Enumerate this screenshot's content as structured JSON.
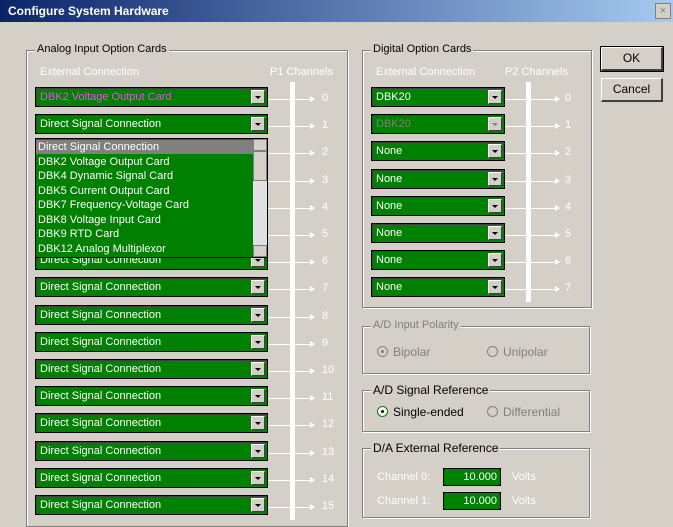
{
  "window": {
    "title": "Configure System Hardware",
    "close_label": "×"
  },
  "analog": {
    "group_label": "Analog Input Option Cards",
    "header_ext": "External Connection",
    "header_ch": "P1 Channels",
    "rows": [
      {
        "ch": "0",
        "value": "DBK2 Voltage Output Card"
      },
      {
        "ch": "1",
        "value": "Direct Signal Connection"
      },
      {
        "ch": "2",
        "value": ""
      },
      {
        "ch": "3",
        "value": ""
      },
      {
        "ch": "4",
        "value": ""
      },
      {
        "ch": "5",
        "value": ""
      },
      {
        "ch": "6",
        "value": "Direct Signal Connection"
      },
      {
        "ch": "7",
        "value": "Direct Signal Connection"
      },
      {
        "ch": "8",
        "value": "Direct Signal Connection"
      },
      {
        "ch": "9",
        "value": "Direct Signal Connection"
      },
      {
        "ch": "10",
        "value": "Direct Signal Connection"
      },
      {
        "ch": "11",
        "value": "Direct Signal Connection"
      },
      {
        "ch": "12",
        "value": "Direct Signal Connection"
      },
      {
        "ch": "13",
        "value": "Direct Signal Connection"
      },
      {
        "ch": "14",
        "value": "Direct Signal Connection"
      },
      {
        "ch": "15",
        "value": "Direct Signal Connection"
      }
    ],
    "dropdown_options": [
      "Direct Signal Connection",
      "DBK2 Voltage Output Card",
      "DBK4 Dynamic Signal Card",
      "DBK5 Current Output Card",
      "DBK7 Frequency-Voltage Card",
      "DBK8 Voltage Input Card",
      "DBK9 RTD Card",
      "DBK12 Analog Multiplexor"
    ],
    "dropdown_selected_index": 0
  },
  "digital": {
    "group_label": "Digital Option Cards",
    "header_ext": "External Connection",
    "header_ch": "P2 Channels",
    "rows": [
      {
        "ch": "0",
        "value": "DBK20"
      },
      {
        "ch": "1",
        "value": "DBK20"
      },
      {
        "ch": "2",
        "value": "None"
      },
      {
        "ch": "3",
        "value": "None"
      },
      {
        "ch": "4",
        "value": "None"
      },
      {
        "ch": "5",
        "value": "None"
      },
      {
        "ch": "6",
        "value": "None"
      },
      {
        "ch": "7",
        "value": "None"
      }
    ]
  },
  "polarity": {
    "group_label": "A/D Input Polarity",
    "bipolar": "Bipolar",
    "unipolar": "Unipolar"
  },
  "signal_ref": {
    "group_label": "A/D Signal Reference",
    "single": "Single-ended",
    "diff": "Differential"
  },
  "da_ref": {
    "group_label": "D/A External Reference",
    "ch0_label": "Channel 0:",
    "ch0_value": "10.000",
    "ch1_label": "Channel 1:",
    "ch1_value": "10.000",
    "unit": "Volts"
  },
  "buttons": {
    "ok": "OK",
    "cancel": "Cancel"
  },
  "colors": {
    "field_green": "#008000",
    "title_blue": "#0a246a",
    "disabled_text": "#808080"
  }
}
